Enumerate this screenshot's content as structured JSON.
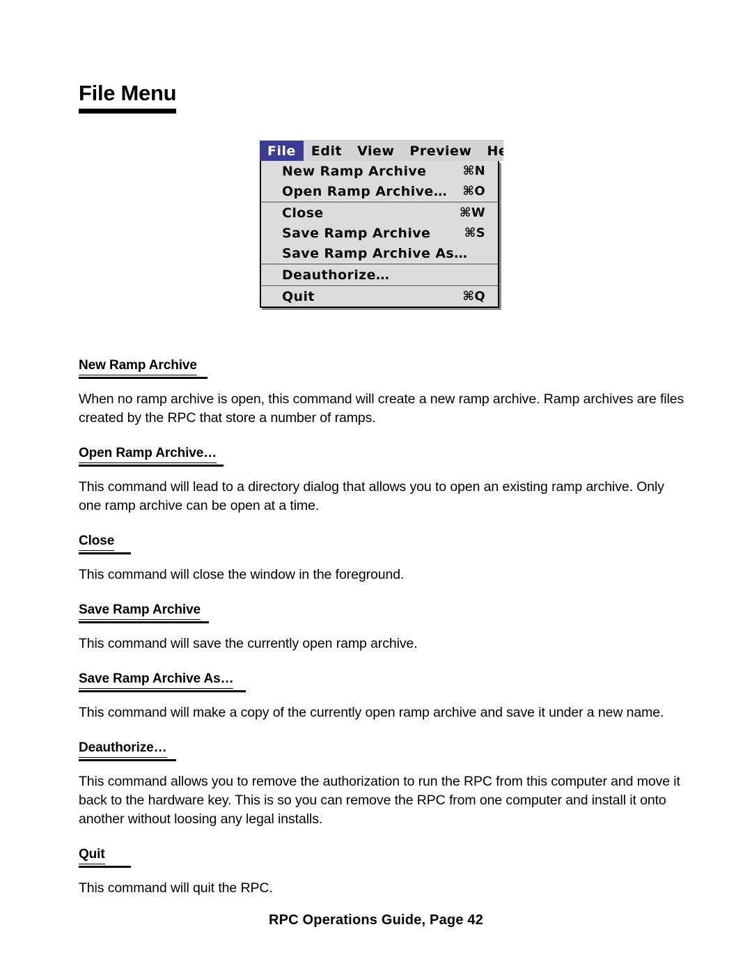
{
  "document": {
    "title": "File Menu",
    "footer": "RPC Operations Guide, Page 42"
  },
  "menu_screenshot": {
    "menubar": [
      {
        "label": "File",
        "selected": true
      },
      {
        "label": "Edit",
        "selected": false
      },
      {
        "label": "View",
        "selected": false
      },
      {
        "label": "Preview",
        "selected": false
      },
      {
        "label": "He",
        "selected": false
      }
    ],
    "dropdown_groups": [
      [
        {
          "label": "New Ramp Archive",
          "shortcut": "⌘N"
        },
        {
          "label": "Open Ramp Archive…",
          "shortcut": "⌘O"
        }
      ],
      [
        {
          "label": "Close",
          "shortcut": "⌘W"
        },
        {
          "label": "Save Ramp Archive",
          "shortcut": "⌘S"
        },
        {
          "label": "Save Ramp Archive As…",
          "shortcut": ""
        }
      ],
      [
        {
          "label": "Deauthorize…",
          "shortcut": ""
        }
      ],
      [
        {
          "label": "Quit",
          "shortcut": "⌘Q"
        }
      ]
    ],
    "colors": {
      "selected_background": "#3b3b96",
      "selected_text": "#ffffff",
      "menu_background": "#dcdcdc",
      "menubar_background": "#d4d4d4",
      "border": "#000000"
    }
  },
  "sections": [
    {
      "heading": "New Ramp Archive",
      "body": "When no ramp archive is open, this command will create a new ramp archive. Ramp archives are files created by the RPC that store a number of ramps."
    },
    {
      "heading": "Open Ramp Archive…",
      "body": "This command will lead to a directory dialog that allows you to open an existing ramp archive. Only one ramp archive can be open at a time."
    },
    {
      "heading": "Close",
      "body": "This command will close the window in the foreground."
    },
    {
      "heading": "Save Ramp Archive",
      "body": "This command will save the currently open ramp archive."
    },
    {
      "heading": "Save Ramp Archive As…",
      "body": "This command will make a copy of the currently open ramp archive and save it under a new name."
    },
    {
      "heading": "Deauthorize…",
      "body": "This command allows you to remove the authorization to run the RPC from this computer and move it back to the hardware key. This is so you can remove the RPC from one computer and install it onto another without loosing any legal installs."
    },
    {
      "heading": "Quit",
      "body": "This command will quit the RPC."
    }
  ]
}
